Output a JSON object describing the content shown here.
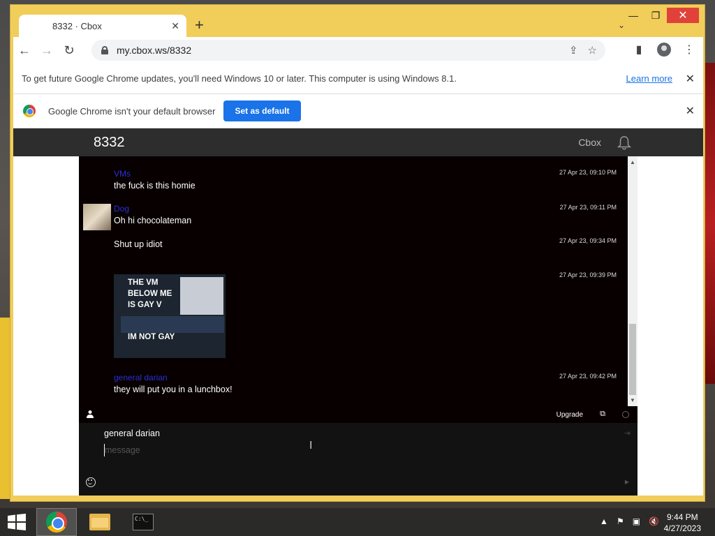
{
  "browser": {
    "tab_title": "8332 · Cbox",
    "url": "my.cbox.ws/8332",
    "new_tab_label": "+",
    "infobar_update": {
      "message": "To get future Google Chrome updates, you'll need Windows 10 or later. This computer is using Windows 8.1.",
      "link": "Learn more"
    },
    "infobar_default": {
      "message": "Google Chrome isn't your default browser",
      "button": "Set as default"
    }
  },
  "cbox": {
    "title": "8332",
    "brand": "Cbox",
    "messages": [
      {
        "user": "VMs",
        "text": "the fuck is this homie",
        "time": "27 Apr 23, 09:10 PM"
      },
      {
        "user": "Dog",
        "text": "Oh hi chocolateman",
        "time": "27 Apr 23, 09:11 PM"
      },
      {
        "user": "",
        "text": "Shut up idiot",
        "time": "27 Apr 23, 09:34 PM"
      },
      {
        "user": "",
        "text": "",
        "time": "27 Apr 23, 09:39 PM",
        "image_text_top": "THE VM BELOW ME IS GAY V",
        "image_text_bottom": "IM NOT GAY"
      },
      {
        "user": "general darian",
        "text": "they will put you in a lunchbox!",
        "time": "27 Apr 23, 09:42 PM"
      }
    ],
    "upgrade_label": "Upgrade",
    "compose": {
      "name": "general darian",
      "placeholder": "message"
    }
  },
  "taskbar": {
    "time": "9:44 PM",
    "date": "4/27/2023"
  },
  "colors": {
    "window_frame": "#f1cd5a",
    "chat_bg": "#080000",
    "username": "#2a2fd8",
    "set_default_button": "#1a73e8"
  }
}
